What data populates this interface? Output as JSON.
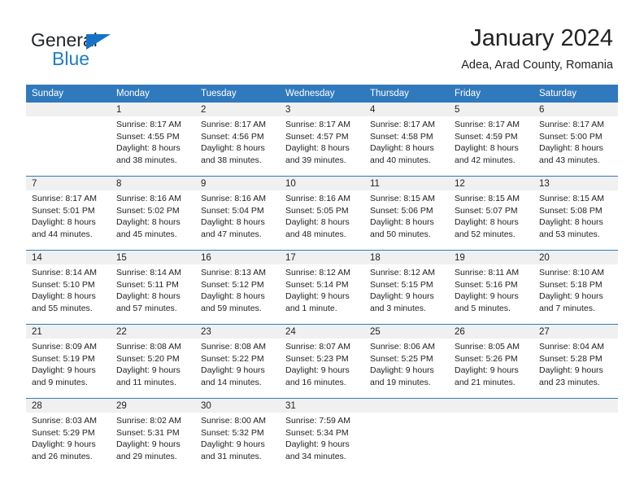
{
  "brand": {
    "word1": "General",
    "word2": "Blue",
    "triangle_color": "#1573c6",
    "word2_color": "#1f7ec4"
  },
  "header": {
    "title": "January 2024",
    "subtitle": "Adea, Arad County, Romania"
  },
  "theme": {
    "header_blue": "#3179bd",
    "daynum_band": "#f0f0f0",
    "text": "#222222"
  },
  "weekday_headers": [
    "Sunday",
    "Monday",
    "Tuesday",
    "Wednesday",
    "Thursday",
    "Friday",
    "Saturday"
  ],
  "labels": {
    "sunrise_prefix": "Sunrise:",
    "sunset_prefix": "Sunset:",
    "daylight_prefix": "Daylight:"
  },
  "weeks": [
    [
      {
        "day": "",
        "sunrise": "",
        "sunset": "",
        "daylight_line1": "",
        "daylight_line2": "",
        "empty": true
      },
      {
        "day": "1",
        "sunrise": "Sunrise: 8:17 AM",
        "sunset": "Sunset: 4:55 PM",
        "daylight_line1": "Daylight: 8 hours",
        "daylight_line2": "and 38 minutes."
      },
      {
        "day": "2",
        "sunrise": "Sunrise: 8:17 AM",
        "sunset": "Sunset: 4:56 PM",
        "daylight_line1": "Daylight: 8 hours",
        "daylight_line2": "and 38 minutes."
      },
      {
        "day": "3",
        "sunrise": "Sunrise: 8:17 AM",
        "sunset": "Sunset: 4:57 PM",
        "daylight_line1": "Daylight: 8 hours",
        "daylight_line2": "and 39 minutes."
      },
      {
        "day": "4",
        "sunrise": "Sunrise: 8:17 AM",
        "sunset": "Sunset: 4:58 PM",
        "daylight_line1": "Daylight: 8 hours",
        "daylight_line2": "and 40 minutes."
      },
      {
        "day": "5",
        "sunrise": "Sunrise: 8:17 AM",
        "sunset": "Sunset: 4:59 PM",
        "daylight_line1": "Daylight: 8 hours",
        "daylight_line2": "and 42 minutes."
      },
      {
        "day": "6",
        "sunrise": "Sunrise: 8:17 AM",
        "sunset": "Sunset: 5:00 PM",
        "daylight_line1": "Daylight: 8 hours",
        "daylight_line2": "and 43 minutes."
      }
    ],
    [
      {
        "day": "7",
        "sunrise": "Sunrise: 8:17 AM",
        "sunset": "Sunset: 5:01 PM",
        "daylight_line1": "Daylight: 8 hours",
        "daylight_line2": "and 44 minutes."
      },
      {
        "day": "8",
        "sunrise": "Sunrise: 8:16 AM",
        "sunset": "Sunset: 5:02 PM",
        "daylight_line1": "Daylight: 8 hours",
        "daylight_line2": "and 45 minutes."
      },
      {
        "day": "9",
        "sunrise": "Sunrise: 8:16 AM",
        "sunset": "Sunset: 5:04 PM",
        "daylight_line1": "Daylight: 8 hours",
        "daylight_line2": "and 47 minutes."
      },
      {
        "day": "10",
        "sunrise": "Sunrise: 8:16 AM",
        "sunset": "Sunset: 5:05 PM",
        "daylight_line1": "Daylight: 8 hours",
        "daylight_line2": "and 48 minutes."
      },
      {
        "day": "11",
        "sunrise": "Sunrise: 8:15 AM",
        "sunset": "Sunset: 5:06 PM",
        "daylight_line1": "Daylight: 8 hours",
        "daylight_line2": "and 50 minutes."
      },
      {
        "day": "12",
        "sunrise": "Sunrise: 8:15 AM",
        "sunset": "Sunset: 5:07 PM",
        "daylight_line1": "Daylight: 8 hours",
        "daylight_line2": "and 52 minutes."
      },
      {
        "day": "13",
        "sunrise": "Sunrise: 8:15 AM",
        "sunset": "Sunset: 5:08 PM",
        "daylight_line1": "Daylight: 8 hours",
        "daylight_line2": "and 53 minutes."
      }
    ],
    [
      {
        "day": "14",
        "sunrise": "Sunrise: 8:14 AM",
        "sunset": "Sunset: 5:10 PM",
        "daylight_line1": "Daylight: 8 hours",
        "daylight_line2": "and 55 minutes."
      },
      {
        "day": "15",
        "sunrise": "Sunrise: 8:14 AM",
        "sunset": "Sunset: 5:11 PM",
        "daylight_line1": "Daylight: 8 hours",
        "daylight_line2": "and 57 minutes."
      },
      {
        "day": "16",
        "sunrise": "Sunrise: 8:13 AM",
        "sunset": "Sunset: 5:12 PM",
        "daylight_line1": "Daylight: 8 hours",
        "daylight_line2": "and 59 minutes."
      },
      {
        "day": "17",
        "sunrise": "Sunrise: 8:12 AM",
        "sunset": "Sunset: 5:14 PM",
        "daylight_line1": "Daylight: 9 hours",
        "daylight_line2": "and 1 minute."
      },
      {
        "day": "18",
        "sunrise": "Sunrise: 8:12 AM",
        "sunset": "Sunset: 5:15 PM",
        "daylight_line1": "Daylight: 9 hours",
        "daylight_line2": "and 3 minutes."
      },
      {
        "day": "19",
        "sunrise": "Sunrise: 8:11 AM",
        "sunset": "Sunset: 5:16 PM",
        "daylight_line1": "Daylight: 9 hours",
        "daylight_line2": "and 5 minutes."
      },
      {
        "day": "20",
        "sunrise": "Sunrise: 8:10 AM",
        "sunset": "Sunset: 5:18 PM",
        "daylight_line1": "Daylight: 9 hours",
        "daylight_line2": "and 7 minutes."
      }
    ],
    [
      {
        "day": "21",
        "sunrise": "Sunrise: 8:09 AM",
        "sunset": "Sunset: 5:19 PM",
        "daylight_line1": "Daylight: 9 hours",
        "daylight_line2": "and 9 minutes."
      },
      {
        "day": "22",
        "sunrise": "Sunrise: 8:08 AM",
        "sunset": "Sunset: 5:20 PM",
        "daylight_line1": "Daylight: 9 hours",
        "daylight_line2": "and 11 minutes."
      },
      {
        "day": "23",
        "sunrise": "Sunrise: 8:08 AM",
        "sunset": "Sunset: 5:22 PM",
        "daylight_line1": "Daylight: 9 hours",
        "daylight_line2": "and 14 minutes."
      },
      {
        "day": "24",
        "sunrise": "Sunrise: 8:07 AM",
        "sunset": "Sunset: 5:23 PM",
        "daylight_line1": "Daylight: 9 hours",
        "daylight_line2": "and 16 minutes."
      },
      {
        "day": "25",
        "sunrise": "Sunrise: 8:06 AM",
        "sunset": "Sunset: 5:25 PM",
        "daylight_line1": "Daylight: 9 hours",
        "daylight_line2": "and 19 minutes."
      },
      {
        "day": "26",
        "sunrise": "Sunrise: 8:05 AM",
        "sunset": "Sunset: 5:26 PM",
        "daylight_line1": "Daylight: 9 hours",
        "daylight_line2": "and 21 minutes."
      },
      {
        "day": "27",
        "sunrise": "Sunrise: 8:04 AM",
        "sunset": "Sunset: 5:28 PM",
        "daylight_line1": "Daylight: 9 hours",
        "daylight_line2": "and 23 minutes."
      }
    ],
    [
      {
        "day": "28",
        "sunrise": "Sunrise: 8:03 AM",
        "sunset": "Sunset: 5:29 PM",
        "daylight_line1": "Daylight: 9 hours",
        "daylight_line2": "and 26 minutes."
      },
      {
        "day": "29",
        "sunrise": "Sunrise: 8:02 AM",
        "sunset": "Sunset: 5:31 PM",
        "daylight_line1": "Daylight: 9 hours",
        "daylight_line2": "and 29 minutes."
      },
      {
        "day": "30",
        "sunrise": "Sunrise: 8:00 AM",
        "sunset": "Sunset: 5:32 PM",
        "daylight_line1": "Daylight: 9 hours",
        "daylight_line2": "and 31 minutes."
      },
      {
        "day": "31",
        "sunrise": "Sunrise: 7:59 AM",
        "sunset": "Sunset: 5:34 PM",
        "daylight_line1": "Daylight: 9 hours",
        "daylight_line2": "and 34 minutes."
      },
      {
        "day": "",
        "sunrise": "",
        "sunset": "",
        "daylight_line1": "",
        "daylight_line2": "",
        "empty": true
      },
      {
        "day": "",
        "sunrise": "",
        "sunset": "",
        "daylight_line1": "",
        "daylight_line2": "",
        "empty": true
      },
      {
        "day": "",
        "sunrise": "",
        "sunset": "",
        "daylight_line1": "",
        "daylight_line2": "",
        "empty": true
      }
    ]
  ]
}
